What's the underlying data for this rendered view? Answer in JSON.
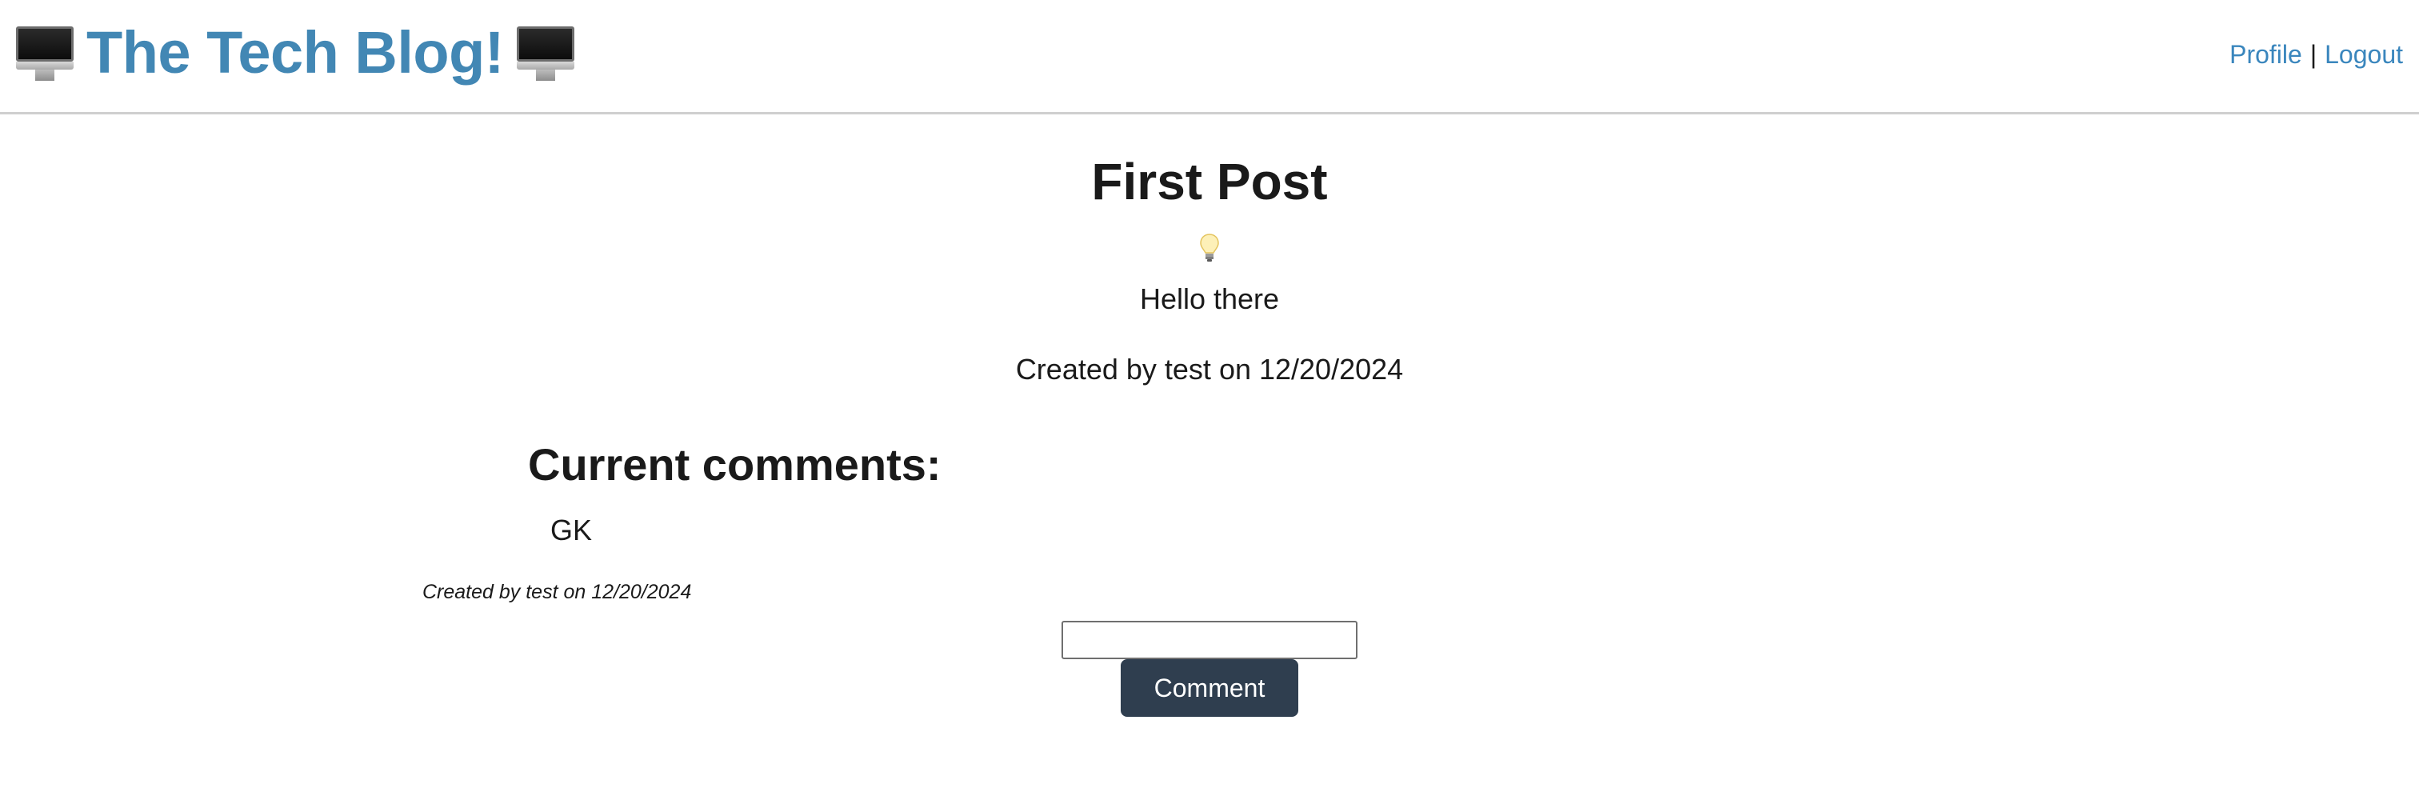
{
  "header": {
    "title": "The Tech Blog!",
    "left_icon": "desktop-computer-icon",
    "right_icon": "desktop-computer-icon",
    "nav": {
      "profile_label": "Profile",
      "separator": "|",
      "logout_label": "Logout"
    },
    "title_color": "#4287b4",
    "link_color": "#3a86bd"
  },
  "post": {
    "title": "First Post",
    "icon": "light-bulb-icon",
    "body": "Hello there",
    "meta": "Created by test on 12/20/2024"
  },
  "comments": {
    "heading": "Current comments:",
    "items": [
      {
        "text": "GK",
        "meta": "Created by test on 12/20/2024"
      }
    ]
  },
  "comment_form": {
    "input_value": "",
    "button_label": "Comment",
    "button_color": "#2f3e4f"
  }
}
